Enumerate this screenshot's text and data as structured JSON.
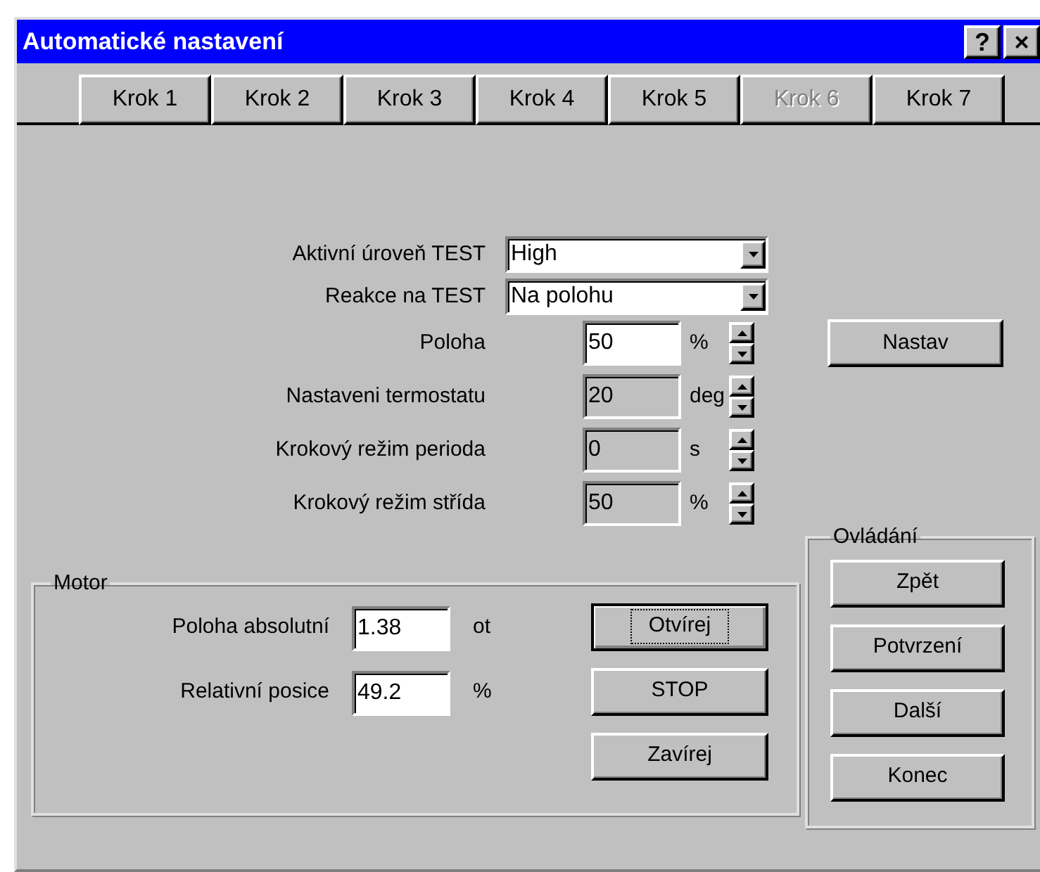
{
  "window": {
    "title": "Automatické nastavení",
    "controls": [
      "?",
      "×"
    ]
  },
  "tabs": [
    {
      "label": "Krok 1",
      "disabled": false
    },
    {
      "label": "Krok 2",
      "disabled": false
    },
    {
      "label": "Krok 3",
      "disabled": false
    },
    {
      "label": "Krok 4",
      "disabled": false
    },
    {
      "label": "Krok 5",
      "disabled": false
    },
    {
      "label": "Krok 6",
      "disabled": true
    },
    {
      "label": "Krok 7",
      "disabled": false
    }
  ],
  "settings": [
    {
      "kind": "dropdown",
      "label": "Aktivní úroveň TEST",
      "value": "High"
    },
    {
      "kind": "dropdown",
      "label": "Reakce na TEST",
      "value": "Na polohu"
    },
    {
      "kind": "spin",
      "label": "Poloha",
      "value": "50",
      "unit": "%",
      "disabled": false
    },
    {
      "kind": "spin",
      "label": "Nastaveni termostatu",
      "value": "20",
      "unit": "deg",
      "disabled": true
    },
    {
      "kind": "spin",
      "label": "Krokový režim perioda",
      "value": "0",
      "unit": "s",
      "disabled": true
    },
    {
      "kind": "spin",
      "label": "Krokový režim střída",
      "value": "50",
      "unit": "%",
      "disabled": true
    }
  ],
  "set_button": "Nastav",
  "motor": {
    "title": "Motor",
    "fields": [
      {
        "label": "Poloha absolutní",
        "value": "1.38",
        "unit": "ot"
      },
      {
        "label": "Relativní posice",
        "value": "49.2",
        "unit": "%"
      }
    ],
    "buttons": [
      {
        "label": "Otvírej",
        "focused": true
      },
      {
        "label": "STOP",
        "focused": false
      },
      {
        "label": "Zavírej",
        "focused": false
      }
    ]
  },
  "controls": {
    "title": "Ovládání",
    "buttons": [
      "Zpět",
      "Potvrzení",
      "Další",
      "Konec"
    ]
  }
}
